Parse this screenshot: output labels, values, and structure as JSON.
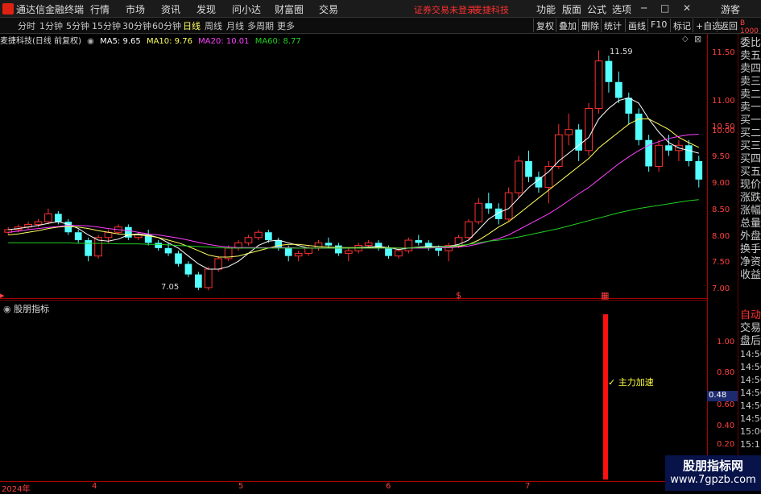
{
  "titlebar": {
    "app_title": "通达信金融终端",
    "menus": [
      "行情",
      "市场",
      "资讯",
      "发现",
      "问小达",
      "财富圈",
      "交易"
    ],
    "login_warning": "证券交易未登录",
    "stock_name": "麦捷科技",
    "right_menus": [
      "功能",
      "版面",
      "公式",
      "选项"
    ],
    "guest": "游客"
  },
  "toolbar": {
    "periods": [
      "分时",
      "1分钟",
      "5分钟",
      "15分钟",
      "30分钟",
      "60分钟",
      "日线",
      "周线",
      "月线",
      "多周期",
      "更多"
    ],
    "active_period": "日线",
    "buttons": [
      "复权",
      "叠加",
      "删除",
      "统计",
      "画线",
      "F10",
      "标记",
      "+自选",
      "返回"
    ]
  },
  "ma_info": {
    "title": "麦捷科技(日线 前复权)",
    "ma5": "MA5: 9.65",
    "ma10": "MA10: 9.76",
    "ma20": "MA20: 10.01",
    "ma60": "MA60: 8.77"
  },
  "price_axis": [
    "11.50",
    "11.00",
    "10.50",
    "10.00",
    "9.50",
    "9.00",
    "8.50",
    "8.00",
    "7.50",
    "7.00"
  ],
  "indicator_axis": [
    "1.00",
    "0.80",
    "0.60",
    "0.40",
    "0.20"
  ],
  "indicator_badge": "0.48",
  "side_labels": [
    "委比",
    "卖五",
    "卖四",
    "卖三",
    "卖二",
    "卖一",
    "买一",
    "买二",
    "买三",
    "买四",
    "买五",
    "现价",
    "涨跌",
    "涨幅",
    "总量",
    "外盘",
    "换手",
    "净资",
    "收益"
  ],
  "side_labels_lower": [
    "自动",
    "交易",
    "盘后",
    "14:56",
    "14:56",
    "14:56",
    "14:56",
    "14:56",
    "14:56",
    "15:00",
    "15:11"
  ],
  "sub_panel_title": "股朋指标",
  "signal_label": "主力加速",
  "high_label": "11.59",
  "low_label": "7.05",
  "x_axis": [
    "2024年",
    "4",
    "5",
    "6",
    "7"
  ],
  "watermark": {
    "line1": "股朋指标网",
    "line2": "www.7gpzb.com"
  },
  "colors": {
    "up": "#ff3030",
    "down": "#54ffff",
    "ma5": "#ffffff",
    "ma10": "#ffff60",
    "ma20": "#ff40ff",
    "ma60": "#20d020"
  },
  "chart_data": {
    "type": "candlestick",
    "ylim": [
      6.9,
      11.7
    ],
    "candles": [
      [
        8.15,
        8.25,
        8.1,
        8.2
      ],
      [
        8.2,
        8.3,
        8.15,
        8.25
      ],
      [
        8.25,
        8.35,
        8.2,
        8.3
      ],
      [
        8.3,
        8.4,
        8.25,
        8.35
      ],
      [
        8.35,
        8.6,
        8.3,
        8.5
      ],
      [
        8.5,
        8.55,
        8.3,
        8.35
      ],
      [
        8.35,
        8.4,
        8.1,
        8.15
      ],
      [
        8.15,
        8.2,
        7.95,
        8.0
      ],
      [
        8.0,
        8.05,
        7.6,
        7.7
      ],
      [
        7.7,
        8.1,
        7.65,
        8.05
      ],
      [
        8.05,
        8.2,
        7.95,
        8.15
      ],
      [
        8.15,
        8.3,
        8.1,
        8.25
      ],
      [
        8.25,
        8.3,
        8.0,
        8.05
      ],
      [
        8.05,
        8.15,
        8.0,
        8.1
      ],
      [
        8.1,
        8.2,
        7.9,
        7.95
      ],
      [
        7.95,
        8.0,
        7.8,
        7.85
      ],
      [
        7.85,
        7.95,
        7.7,
        7.75
      ],
      [
        7.75,
        7.8,
        7.5,
        7.55
      ],
      [
        7.55,
        7.6,
        7.3,
        7.35
      ],
      [
        7.35,
        7.4,
        7.05,
        7.1
      ],
      [
        7.1,
        7.5,
        7.05,
        7.45
      ],
      [
        7.45,
        7.7,
        7.4,
        7.65
      ],
      [
        7.65,
        7.9,
        7.6,
        7.85
      ],
      [
        7.85,
        8.0,
        7.8,
        7.95
      ],
      [
        7.95,
        8.1,
        7.9,
        8.05
      ],
      [
        8.05,
        8.2,
        8.0,
        8.15
      ],
      [
        8.15,
        8.2,
        7.95,
        8.0
      ],
      [
        8.0,
        8.05,
        7.8,
        7.85
      ],
      [
        7.85,
        7.9,
        7.6,
        7.7
      ],
      [
        7.7,
        7.8,
        7.6,
        7.75
      ],
      [
        7.75,
        7.9,
        7.7,
        7.85
      ],
      [
        7.85,
        8.0,
        7.8,
        7.95
      ],
      [
        7.95,
        8.05,
        7.85,
        7.9
      ],
      [
        7.9,
        7.95,
        7.7,
        7.75
      ],
      [
        7.75,
        7.85,
        7.6,
        7.8
      ],
      [
        7.8,
        7.95,
        7.75,
        7.9
      ],
      [
        7.9,
        8.0,
        7.85,
        7.95
      ],
      [
        7.95,
        8.0,
        7.8,
        7.85
      ],
      [
        7.85,
        7.9,
        7.65,
        7.7
      ],
      [
        7.7,
        7.85,
        7.65,
        7.8
      ],
      [
        7.8,
        8.05,
        7.75,
        8.0
      ],
      [
        8.0,
        8.1,
        7.9,
        7.95
      ],
      [
        7.95,
        8.0,
        7.8,
        7.85
      ],
      [
        7.85,
        7.9,
        7.7,
        7.8
      ],
      [
        7.8,
        7.95,
        7.6,
        7.9
      ],
      [
        7.9,
        8.1,
        7.85,
        8.05
      ],
      [
        8.05,
        8.4,
        8.0,
        8.35
      ],
      [
        8.35,
        8.8,
        8.3,
        8.7
      ],
      [
        8.7,
        8.9,
        8.5,
        8.6
      ],
      [
        8.6,
        8.7,
        8.3,
        8.4
      ],
      [
        8.4,
        9.0,
        8.35,
        8.9
      ],
      [
        8.9,
        9.6,
        8.8,
        9.5
      ],
      [
        9.5,
        9.7,
        9.1,
        9.2
      ],
      [
        9.2,
        9.3,
        8.9,
        9.0
      ],
      [
        9.0,
        9.5,
        8.7,
        9.4
      ],
      [
        9.4,
        10.2,
        9.35,
        10.0
      ],
      [
        10.0,
        10.4,
        9.8,
        10.1
      ],
      [
        10.1,
        10.2,
        9.5,
        9.7
      ],
      [
        9.7,
        10.6,
        9.6,
        10.5
      ],
      [
        10.5,
        11.6,
        10.4,
        11.4
      ],
      [
        11.4,
        11.5,
        10.8,
        11.0
      ],
      [
        11.0,
        11.2,
        10.6,
        10.7
      ],
      [
        10.7,
        10.8,
        10.2,
        10.4
      ],
      [
        10.4,
        10.5,
        9.8,
        9.9
      ],
      [
        9.9,
        10.0,
        9.3,
        9.4
      ],
      [
        9.4,
        9.9,
        9.3,
        9.8
      ],
      [
        9.8,
        10.0,
        9.6,
        9.7
      ],
      [
        9.7,
        9.9,
        9.5,
        9.8
      ],
      [
        9.8,
        9.9,
        9.4,
        9.5
      ],
      [
        9.5,
        9.6,
        9.0,
        9.15
      ]
    ],
    "ma5": [
      8.2,
      8.22,
      8.25,
      8.28,
      8.32,
      8.35,
      8.3,
      8.22,
      8.1,
      8.0,
      7.98,
      8.02,
      8.1,
      8.12,
      8.1,
      8.05,
      7.95,
      7.85,
      7.7,
      7.55,
      7.45,
      7.45,
      7.5,
      7.6,
      7.75,
      7.9,
      7.98,
      8.0,
      7.95,
      7.9,
      7.85,
      7.85,
      7.85,
      7.85,
      7.85,
      7.86,
      7.87,
      7.88,
      7.86,
      7.82,
      7.85,
      7.87,
      7.88,
      7.88,
      7.88,
      7.92,
      8.0,
      8.2,
      8.4,
      8.52,
      8.6,
      8.8,
      9.0,
      9.15,
      9.3,
      9.5,
      9.65,
      9.8,
      9.95,
      10.3,
      10.5,
      10.65,
      10.7,
      10.6,
      10.3,
      10.05,
      9.85,
      9.75,
      9.7,
      9.65
    ],
    "ma10": [
      8.1,
      8.12,
      8.15,
      8.18,
      8.22,
      8.25,
      8.26,
      8.25,
      8.22,
      8.18,
      8.15,
      8.12,
      8.1,
      8.1,
      8.08,
      8.05,
      8.0,
      7.95,
      7.88,
      7.8,
      7.72,
      7.68,
      7.68,
      7.7,
      7.75,
      7.8,
      7.85,
      7.9,
      7.92,
      7.92,
      7.9,
      7.88,
      7.87,
      7.86,
      7.86,
      7.86,
      7.86,
      7.86,
      7.86,
      7.85,
      7.85,
      7.86,
      7.86,
      7.87,
      7.87,
      7.88,
      7.92,
      8.0,
      8.12,
      8.25,
      8.35,
      8.5,
      8.65,
      8.8,
      8.95,
      9.1,
      9.25,
      9.4,
      9.55,
      9.75,
      9.9,
      10.05,
      10.2,
      10.3,
      10.3,
      10.2,
      10.1,
      9.95,
      9.85,
      9.76
    ],
    "ma20": [
      8.15,
      8.17,
      8.2,
      8.22,
      8.24,
      8.26,
      8.28,
      8.28,
      8.27,
      8.25,
      8.22,
      8.2,
      8.18,
      8.15,
      8.12,
      8.1,
      8.07,
      8.04,
      8.0,
      7.96,
      7.92,
      7.89,
      7.87,
      7.86,
      7.86,
      7.86,
      7.86,
      7.86,
      7.86,
      7.85,
      7.85,
      7.85,
      7.85,
      7.85,
      7.85,
      7.85,
      7.85,
      7.85,
      7.85,
      7.85,
      7.85,
      7.85,
      7.85,
      7.86,
      7.86,
      7.87,
      7.89,
      7.93,
      7.98,
      8.03,
      8.1,
      8.2,
      8.3,
      8.4,
      8.5,
      8.62,
      8.75,
      8.88,
      9.0,
      9.15,
      9.3,
      9.45,
      9.58,
      9.7,
      9.8,
      9.87,
      9.93,
      9.97,
      10.0,
      10.01
    ],
    "ma60": [
      7.95,
      7.95,
      7.95,
      7.95,
      7.95,
      7.95,
      7.95,
      7.94,
      7.94,
      7.94,
      7.94,
      7.93,
      7.93,
      7.93,
      7.92,
      7.92,
      7.91,
      7.9,
      7.89,
      7.88,
      7.87,
      7.86,
      7.85,
      7.85,
      7.85,
      7.85,
      7.85,
      7.85,
      7.85,
      7.85,
      7.85,
      7.85,
      7.85,
      7.85,
      7.85,
      7.85,
      7.85,
      7.85,
      7.85,
      7.85,
      7.85,
      7.86,
      7.86,
      7.87,
      7.88,
      7.9,
      7.92,
      7.95,
      7.98,
      8.0,
      8.03,
      8.06,
      8.1,
      8.14,
      8.18,
      8.22,
      8.27,
      8.32,
      8.37,
      8.42,
      8.47,
      8.52,
      8.56,
      8.6,
      8.63,
      8.66,
      8.69,
      8.72,
      8.75,
      8.77
    ]
  }
}
